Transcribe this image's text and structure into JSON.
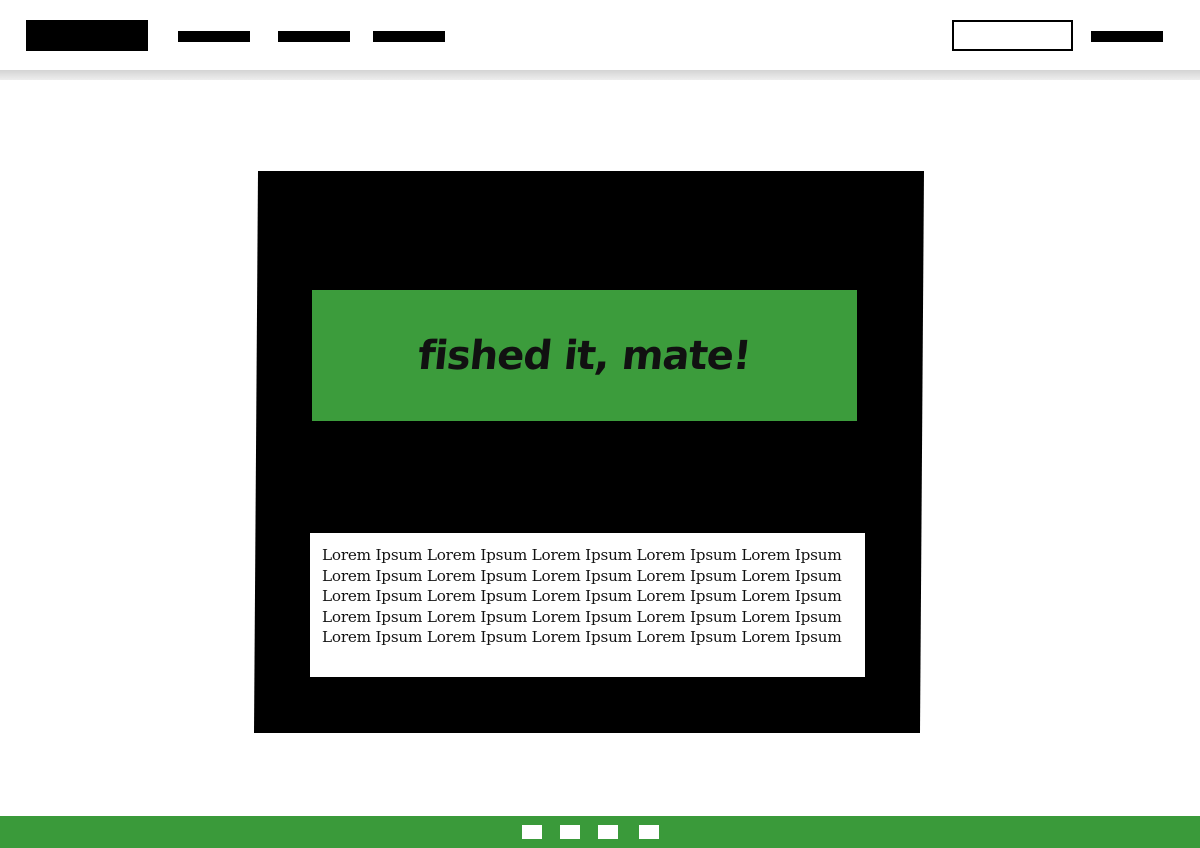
{
  "colors": {
    "accent_green": "#3c9c3c",
    "panel": "#000000",
    "background": "#ffffff"
  },
  "hero": {
    "banner_text": "fished it, mate!"
  },
  "body_text": {
    "lines": [
      "Lorem Ipsum Lorem Ipsum Lorem Ipsum Lorem Ipsum Lorem Ipsum",
      "Lorem Ipsum Lorem Ipsum Lorem Ipsum Lorem Ipsum Lorem Ipsum",
      "Lorem Ipsum Lorem Ipsum Lorem Ipsum Lorem Ipsum Lorem Ipsum",
      "Lorem Ipsum Lorem Ipsum Lorem Ipsum Lorem Ipsum Lorem Ipsum",
      "Lorem Ipsum Lorem Ipsum Lorem Ipsum Lorem Ipsum Lorem Ipsum"
    ]
  }
}
